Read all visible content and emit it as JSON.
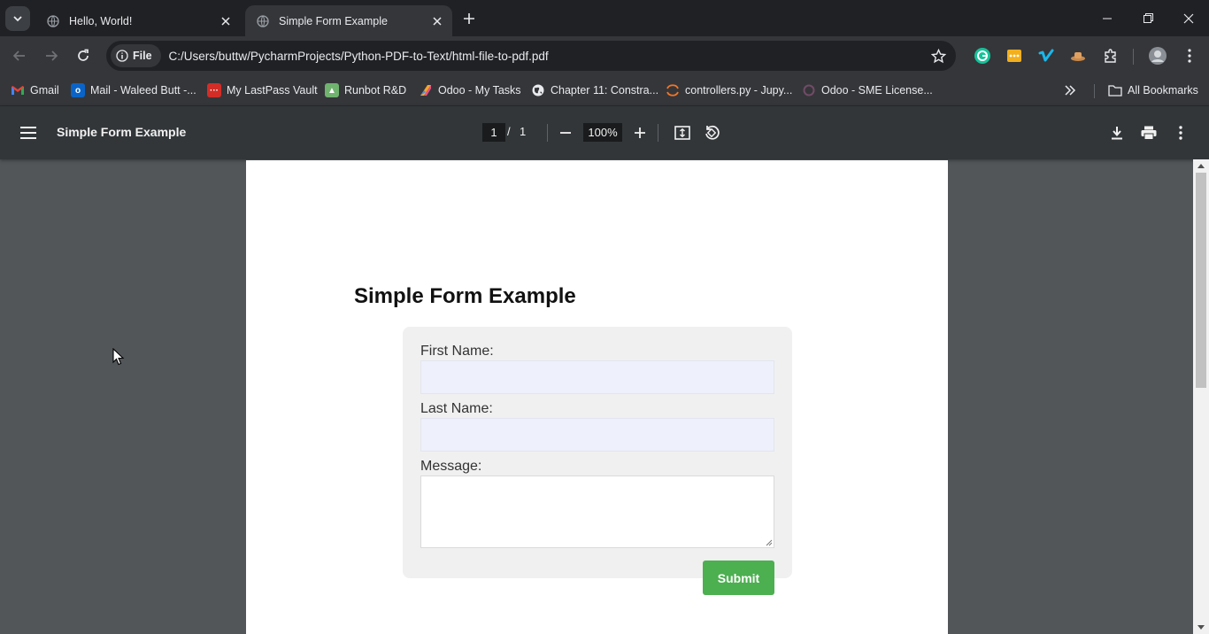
{
  "browser": {
    "tabs": [
      {
        "title": "Hello, World!",
        "active": false
      },
      {
        "title": "Simple Form Example",
        "active": true
      }
    ],
    "address": {
      "chip_label": "File",
      "url": "C:/Users/buttw/PycharmProjects/Python-PDF-to-Text/html-file-to-pdf.pdf"
    },
    "bookmarks": [
      {
        "label": "Gmail",
        "icon": "gmail-icon"
      },
      {
        "label": "Mail - Waleed Butt -...",
        "icon": "outlook-icon"
      },
      {
        "label": "My LastPass Vault",
        "icon": "lastpass-icon"
      },
      {
        "label": "Runbot R&D",
        "icon": "runbot-icon"
      },
      {
        "label": "Odoo - My Tasks",
        "icon": "odoo-tasks-icon"
      },
      {
        "label": "Chapter 11: Constra...",
        "icon": "globe-icon"
      },
      {
        "label": "controllers.py - Jupy...",
        "icon": "jupyter-icon"
      },
      {
        "label": "Odoo - SME License...",
        "icon": "odoo-icon"
      }
    ],
    "all_bookmarks_label": "All Bookmarks"
  },
  "pdf_viewer": {
    "title": "Simple Form Example",
    "current_page": "1",
    "page_separator": "/",
    "total_pages": "1",
    "zoom": "100%"
  },
  "document": {
    "heading": "Simple Form Example",
    "first_name_label": "First Name:",
    "last_name_label": "Last Name:",
    "message_label": "Message:",
    "submit_label": "Submit"
  },
  "colors": {
    "submit_green": "#4caf50",
    "viewer_background": "#525659",
    "toolbar": "#323639"
  }
}
